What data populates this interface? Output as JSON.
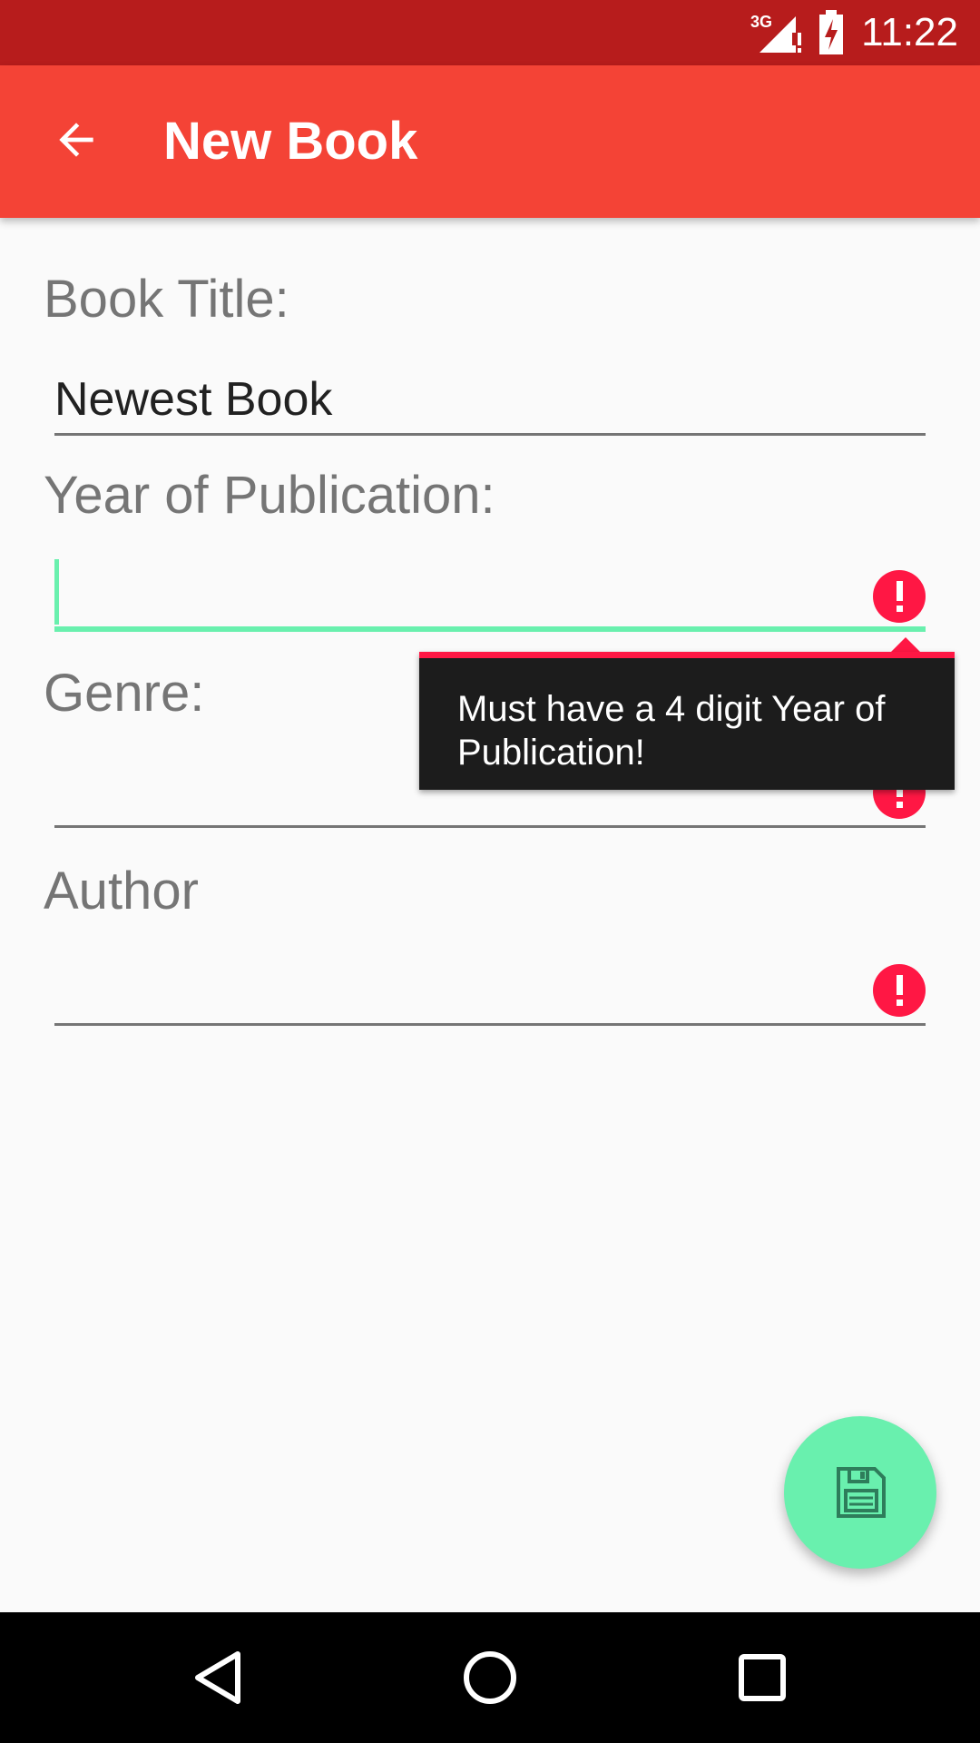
{
  "status_bar": {
    "network": "3G",
    "time": "11:22"
  },
  "app_bar": {
    "title": "New Book"
  },
  "form": {
    "title_label": "Book Title:",
    "title_value": "Newest Book",
    "year_label": "Year of Publication:",
    "year_value": "",
    "genre_label": "Genre:",
    "genre_value": "",
    "author_label": "Author",
    "author_value": ""
  },
  "error_tooltip": {
    "message": "Must have a 4 digit Year of Publication!"
  },
  "colors": {
    "status_bar": "#b71c1c",
    "app_bar": "#f44336",
    "accent": "#69f0ae",
    "error": "#ff1744",
    "label_gray": "#757575"
  },
  "icons": {
    "back": "arrow-back-icon",
    "error": "error-icon",
    "fab": "save-floppy-icon",
    "nav": [
      "back-triangle-icon",
      "home-circle-icon",
      "recents-square-icon"
    ]
  }
}
